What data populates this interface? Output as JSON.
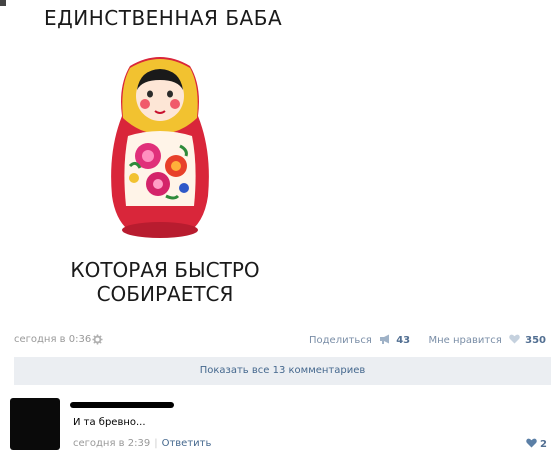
{
  "post": {
    "image_text_top": "ЕДИНСТВЕННАЯ БАБА",
    "image_text_bottom": "КОТОРАЯ БЫСТРО СОБИРАЕТСЯ",
    "time": "сегодня в 0:36",
    "share_label": "Поделиться",
    "share_count": "43",
    "like_label": "Мне нравится",
    "like_count": "350"
  },
  "comments": {
    "show_all_label": "Показать все 13 комментариев",
    "items": [
      {
        "text": "И та бревно...",
        "time": "сегодня в 2:39",
        "reply_label": "Ответить",
        "likes": "2"
      }
    ]
  },
  "icons": {
    "settings": "gear-icon",
    "share": "megaphone-icon",
    "like": "heart-icon"
  },
  "colors": {
    "link": "#45688e",
    "muted": "#999999",
    "panel": "#ebeef2",
    "like_heart": "#9fb2c7",
    "comment_heart": "#5b7fa6"
  }
}
